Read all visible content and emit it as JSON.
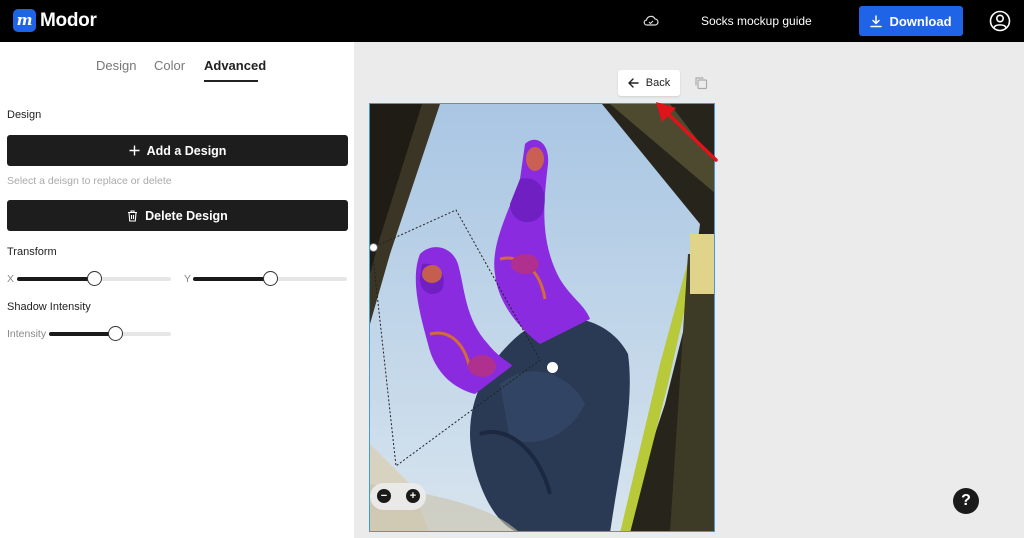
{
  "app": {
    "name": "Modor",
    "logo_letter": "m",
    "brand_color": "#1f63e6"
  },
  "header": {
    "cloud_icon": "cloud-icon",
    "title": "Socks mockup guide",
    "download_label": "Download",
    "download_icon": "download-icon",
    "account_icon": "account-icon"
  },
  "panel": {
    "tabs": [
      {
        "label": "Design",
        "active": false
      },
      {
        "label": "Color",
        "active": false
      },
      {
        "label": "Advanced",
        "active": true
      }
    ],
    "design_section": "Design",
    "add_design_label": "Add a Design",
    "hint": "Select a deisgn to replace or delete",
    "delete_design_label": "Delete Design",
    "transform_section": "Transform",
    "x_label": "X",
    "y_label": "Y",
    "x_value": 0.5,
    "y_value": 0.5,
    "shadow_section": "Shadow Intensity",
    "intensity_label": "Intensity",
    "intensity_value": 0.54
  },
  "canvas": {
    "back_label": "Back",
    "copy_icon": "copy-icon",
    "zoom_out_icon": "zoom-out-icon",
    "zoom_in_icon": "zoom-in-icon",
    "help_label": "?",
    "selection_color": "#3d9ce0",
    "annotation_color": "#e0121a"
  }
}
